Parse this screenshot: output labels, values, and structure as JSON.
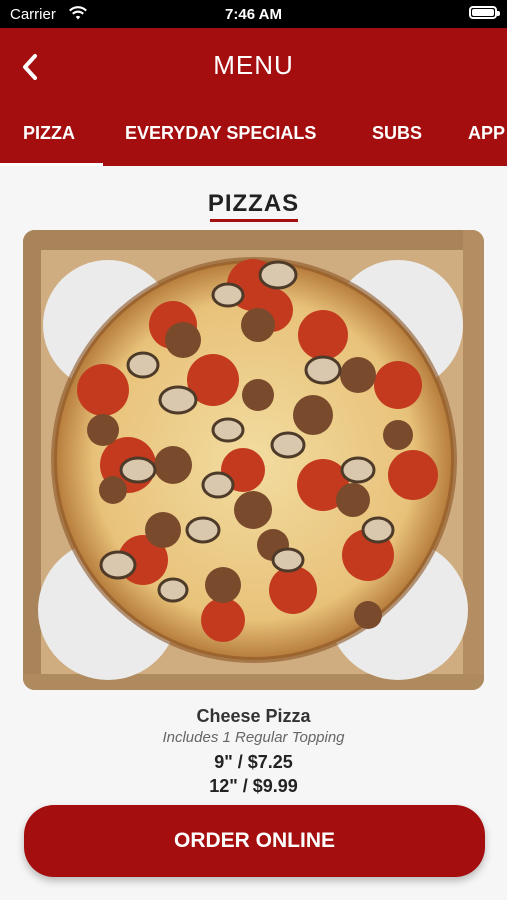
{
  "status_bar": {
    "carrier": "Carrier",
    "time": "7:46 AM"
  },
  "header": {
    "title": "MENU"
  },
  "tabs": [
    {
      "label": "PIZZA",
      "active": true
    },
    {
      "label": "EVERYDAY SPECIALS"
    },
    {
      "label": "SUBS"
    },
    {
      "label": "APP"
    }
  ],
  "section": {
    "title": "PIZZAS"
  },
  "item": {
    "name": "Cheese Pizza",
    "description": "Includes 1 Regular Topping",
    "prices": [
      "9\" / $7.25",
      "12\" / $9.99"
    ]
  },
  "order_button": {
    "label": "ORDER ONLINE"
  },
  "colors": {
    "brand": "#a50e0e"
  }
}
